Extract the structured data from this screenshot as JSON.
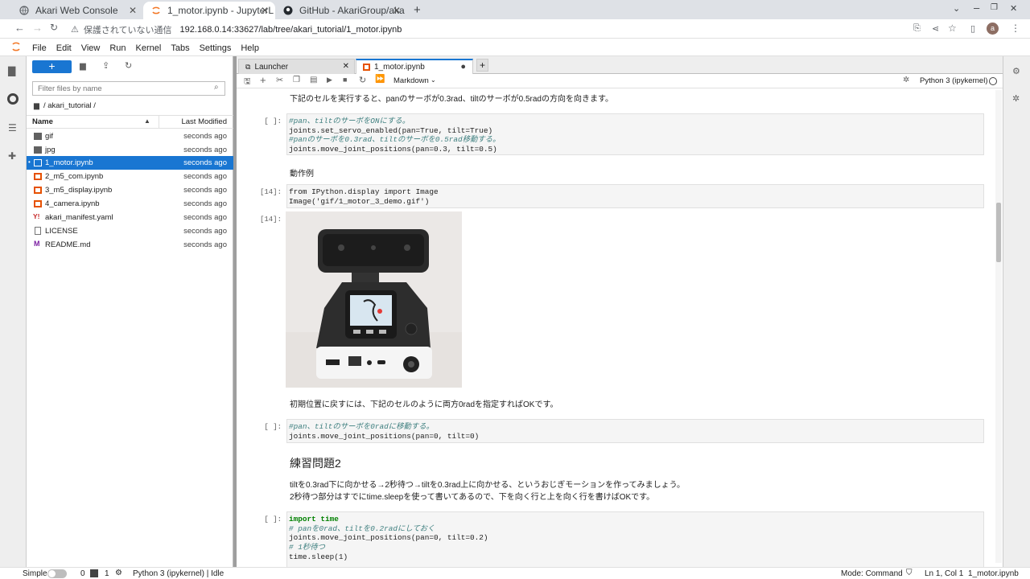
{
  "browser": {
    "tabs": [
      {
        "title": "Akari Web Console",
        "active": false
      },
      {
        "title": "1_motor.ipynb - JupyterL",
        "active": true
      },
      {
        "title": "GitHub - AkariGroup/aka",
        "active": false
      }
    ],
    "security_label": "保護されていない通信",
    "url": "192.168.0.14:33627/lab/tree/akari_tutorial/1_motor.ipynb",
    "profile_initial": "a"
  },
  "menubar": {
    "items": [
      "File",
      "Edit",
      "View",
      "Run",
      "Kernel",
      "Tabs",
      "Settings",
      "Help"
    ]
  },
  "filebrowser": {
    "new_label": "+",
    "filter_placeholder": "Filter files by name",
    "breadcrumb": "/ akari_tutorial /",
    "col_name": "Name",
    "col_modified": "Last Modified",
    "files": [
      {
        "name": "gif",
        "type": "folder",
        "modified": "seconds ago",
        "selected": false
      },
      {
        "name": "jpg",
        "type": "folder",
        "modified": "seconds ago",
        "selected": false
      },
      {
        "name": "1_motor.ipynb",
        "type": "notebook",
        "modified": "seconds ago",
        "selected": true
      },
      {
        "name": "2_m5_com.ipynb",
        "type": "notebook",
        "modified": "seconds ago",
        "selected": false
      },
      {
        "name": "3_m5_display.ipynb",
        "type": "notebook",
        "modified": "seconds ago",
        "selected": false
      },
      {
        "name": "4_camera.ipynb",
        "type": "notebook",
        "modified": "seconds ago",
        "selected": false
      },
      {
        "name": "akari_manifest.yaml",
        "type": "yaml",
        "modified": "seconds ago",
        "selected": false
      },
      {
        "name": "LICENSE",
        "type": "file",
        "modified": "seconds ago",
        "selected": false
      },
      {
        "name": "README.md",
        "type": "markdown",
        "modified": "seconds ago",
        "selected": false
      }
    ]
  },
  "doctabs": [
    {
      "title": "Launcher",
      "active": false
    },
    {
      "title": "1_motor.ipynb",
      "active": true
    }
  ],
  "nbtoolbar": {
    "cell_type": "Markdown",
    "kernel": "Python 3 (ipykernel)"
  },
  "notebook": {
    "md1": "下記のセルを実行すると、panのサーボが0.3rad、tiltのサーボが0.5radの方向を向きます。",
    "cell1_prompt": "[ ]:",
    "cell1_lines": [
      "#pan、tiltのサーボをONにする。",
      "joints.set_servo_enabled(pan=True, tilt=True)",
      "#panのサーボを0.3rad、tiltのサーボを0.5rad移動する。",
      "joints.move_joint_positions(pan=0.3, tilt=0.5)"
    ],
    "md2": "動作例",
    "cell2_prompt": "[14]:",
    "cell2_lines": [
      "from IPython.display import Image",
      "Image('gif/1_motor_3_demo.gif')"
    ],
    "out2_prompt": "[14]:",
    "md3": "初期位置に戻すには、下記のセルのように両方0radを指定すればOKです。",
    "cell3_prompt": "[ ]:",
    "cell3_lines": [
      "#pan、tiltのサーボを0radに移動する。",
      "joints.move_joint_positions(pan=0, tilt=0)"
    ],
    "heading": "練習問題2",
    "md4_line1": "tiltを0.3rad下に向かせる→2秒待つ→tiltを0.3rad上に向かせる、というおじぎモーションを作ってみましょう。",
    "md4_line2": "2秒待つ部分はすでにtime.sleepを使って書いてあるので、下を向く行と上を向く行を書けばOKです。",
    "cell4_prompt": "[ ]:",
    "cell4_lines": [
      "import time",
      "# panを0rad、tiltを0.2radにしておく",
      "joints.move_joint_positions(pan=0, tilt=0.2)",
      "# 1秒待つ",
      "time.sleep(1)"
    ]
  },
  "statusbar": {
    "mode_simple": "Simple",
    "terminals": "0",
    "kernels": "1",
    "kernel_status": "Python 3 (ipykernel) | Idle",
    "mode": "Mode: Command",
    "position": "Ln 1, Col 1",
    "filename": "1_motor.ipynb"
  }
}
